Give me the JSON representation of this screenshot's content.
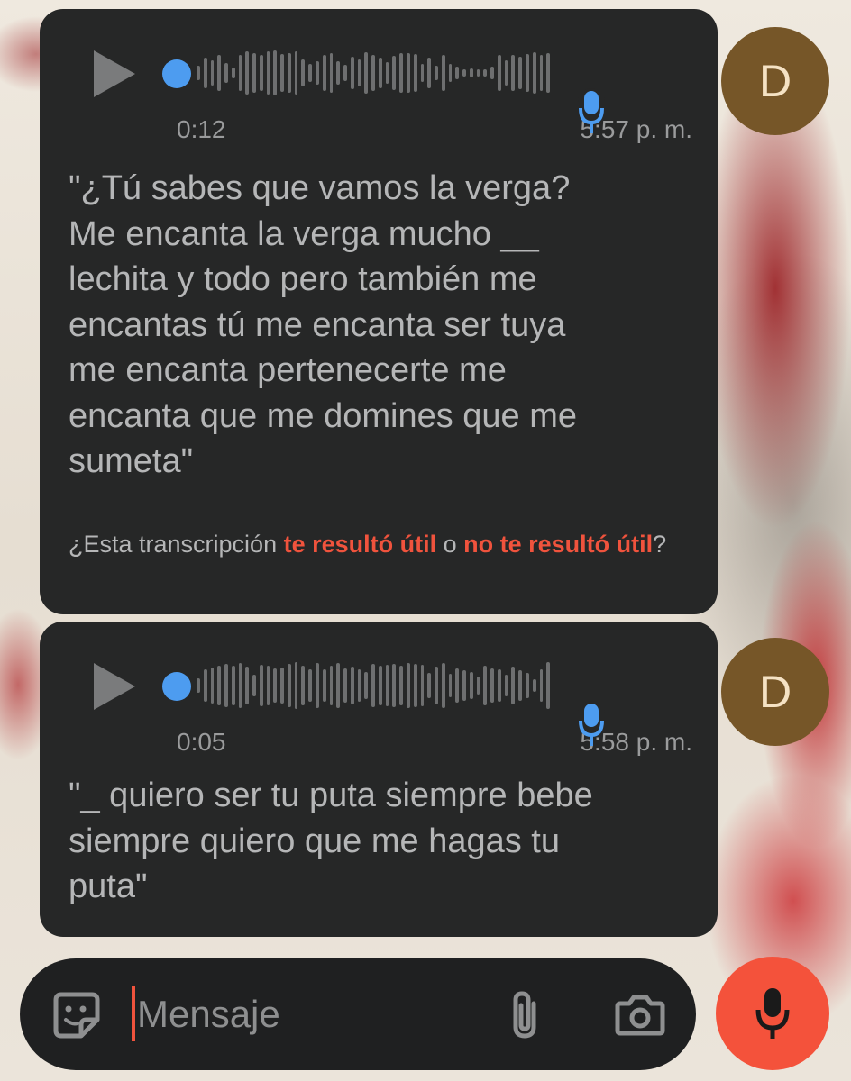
{
  "messages": [
    {
      "duration": "0:12",
      "time": "5:57 p. m.",
      "avatar_letter": "D",
      "transcript": "\"¿Tú sabes que vamos la verga?\nMe encanta la verga mucho __\nlechita y todo pero también me\nencantas tú me encanta ser tuya\nme encanta pertenecerte me\nencanta que me domines que me\nsumeta\"",
      "feedback": {
        "prefix": "¿Esta transcripción ",
        "useful_link": "te resultó útil",
        "middle": " o ",
        "not_useful_link": "no te resultó útil",
        "suffix": "?"
      },
      "waveform": [
        16,
        34,
        28,
        40,
        22,
        12,
        40,
        48,
        44,
        40,
        48,
        50,
        42,
        44,
        48,
        30,
        20,
        26,
        40,
        44,
        26,
        18,
        36,
        30,
        46,
        40,
        34,
        24,
        38,
        44,
        44,
        42,
        20,
        34,
        16,
        40,
        20,
        14,
        8,
        10,
        8,
        8,
        14,
        40,
        28,
        40,
        36,
        42,
        46,
        40,
        44
      ]
    },
    {
      "duration": "0:05",
      "time": "5:58 p. m.",
      "avatar_letter": "D",
      "transcript": "\"_ quiero ser tu puta siempre bebe\nsiempre quiero que me hagas tu\nputa\"",
      "waveform": [
        16,
        36,
        40,
        44,
        48,
        44,
        50,
        42,
        24,
        46,
        44,
        38,
        40,
        48,
        52,
        44,
        36,
        50,
        36,
        44,
        50,
        38,
        42,
        36,
        30,
        48,
        44,
        46,
        48,
        44,
        50,
        48,
        46,
        28,
        42,
        50,
        26,
        38,
        34,
        30,
        20,
        44,
        38,
        36,
        24,
        42,
        34,
        28,
        14,
        36,
        52
      ]
    }
  ],
  "composer": {
    "placeholder": "Mensaje",
    "icons": [
      "emoji-sticker-icon",
      "paperclip-icon",
      "camera-icon",
      "microphone-icon"
    ]
  },
  "colors": {
    "bubble": "#262727",
    "accent_blue": "#4d9cf0",
    "accent_orange": "#f4523b",
    "avatar": "#765628"
  }
}
